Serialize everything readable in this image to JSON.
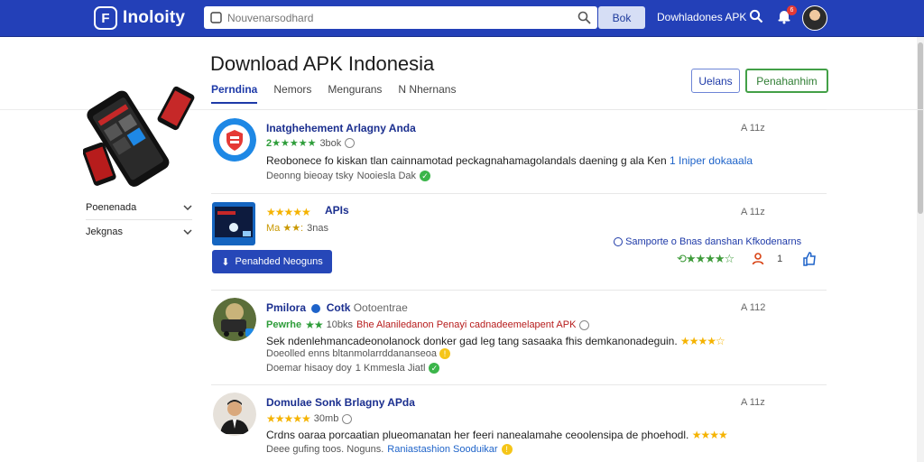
{
  "header": {
    "logo_text": "Inoloity",
    "search_placeholder": "Nouvenarsodhard",
    "search_button": "Bok",
    "top_link": "Dowhladones APK",
    "notification_count": "6"
  },
  "page": {
    "title": "Download APK Indonesia",
    "tabs": [
      "Perndina",
      "Nemors",
      "Mengurans",
      "N Nhernans"
    ],
    "button_outline_1": "Uelans",
    "button_outline_2": "Penahanhim"
  },
  "sidebar": {
    "items": [
      "Poenenada",
      "Jekgnas"
    ]
  },
  "apps": [
    {
      "title": "Inatghehement Arlagny Anda",
      "rating_text": "2★★★★★",
      "count": "3bok",
      "description": "Reobonece fo kiskan tlan cainnamotad peckagnahamagolandals daening g ala Ken",
      "description_link": "1 Iniper dokaaala",
      "footer": "Deonng bieoay tsky",
      "footer_tag": "Nooiesla Dak",
      "size": "A 11z"
    },
    {
      "title": "APIs",
      "rating_text": "Ma ★★:",
      "count": "3nas",
      "download_button": "Penahded Neoguns",
      "note": "Samporte o Bnas danshan Kfkodenarns",
      "like_count": "1",
      "size": "A 11z"
    },
    {
      "title": "Pmilora",
      "title_extra": "Cotk",
      "title_sub": "Ootoentrae",
      "rating_text": "Pewrhe",
      "count": "10bks",
      "highlight": "Bhe Alaniledanon Penayi cadnadeemelapent APK",
      "description": "Sek ndenlehmancadeonolanock donker gad leg tang sasaaka fhis demkanonadeguin.",
      "description_line2": "Doeolled enns bltanmolarrddananseoa",
      "footer": "Doemar hisaoy doy",
      "footer_tag": "1 Kmmesla Jiatl",
      "size": "A 112"
    },
    {
      "title": "Domulae Sonk Brlagny APda",
      "count": "30mb",
      "description": "Crdns oaraa porcaatian plueomanatan her feeri nanealamahe ceoolensipa de phoehodl.",
      "footer": "Deee gufing toos. Noguns.",
      "footer_link": "Raniastashion Sooduikar",
      "size": "A 11z"
    }
  ],
  "colors": {
    "header_bg": "#2340b8",
    "accent_blue": "#1e3aa8",
    "accent_green": "#43a047",
    "star": "#f5b301"
  }
}
